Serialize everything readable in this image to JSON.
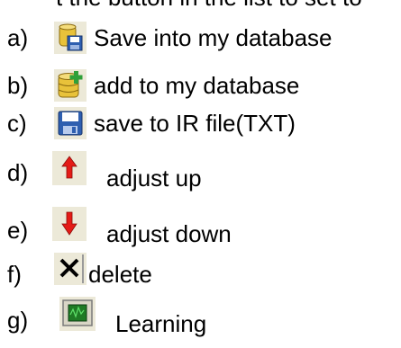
{
  "header_fragment": "t the button in the list to set to",
  "items": [
    {
      "letter": "a)",
      "label": "Save into my database",
      "icon": "database-save-icon"
    },
    {
      "letter": "b)",
      "label": "add to my database",
      "icon": "database-add-icon"
    },
    {
      "letter": "c)",
      "label": "save to IR file(TXT)",
      "icon": "floppy-disk-icon"
    },
    {
      "letter": "d)",
      "label": "adjust up",
      "icon": "arrow-up-icon"
    },
    {
      "letter": "e)",
      "label": "adjust down",
      "icon": "arrow-down-icon"
    },
    {
      "letter": "f)",
      "label": "delete",
      "icon": "close-x-icon"
    },
    {
      "letter": "g)",
      "label": "Learning",
      "icon": "learning-screen-icon"
    }
  ],
  "colors": {
    "icon_bg": "#ece9d8",
    "arrow_red": "#e41b17",
    "floppy_blue": "#2e5fb0",
    "db_yellow": "#e8c23a",
    "plus_green": "#2fa03a",
    "screen_green": "#1f7a25"
  }
}
